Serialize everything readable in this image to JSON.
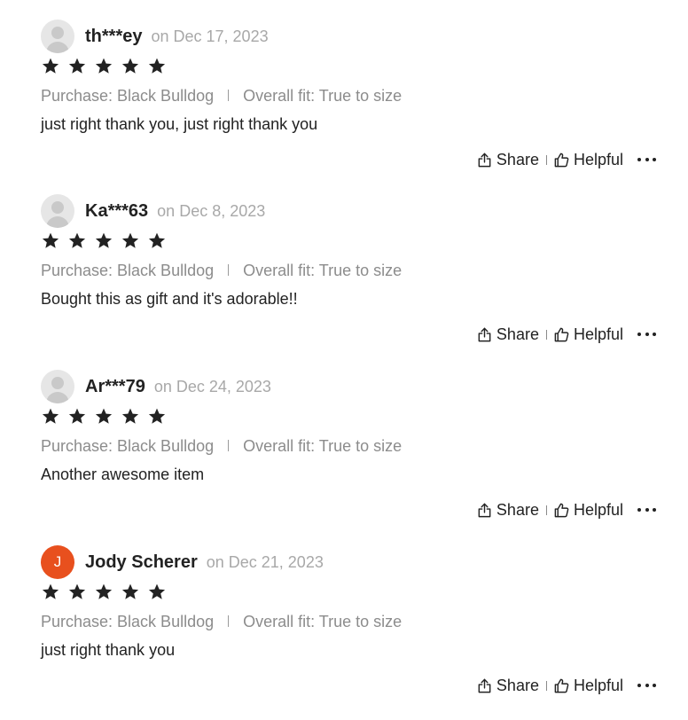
{
  "reviews": [
    {
      "username": "th***ey",
      "date": "on Dec 17, 2023",
      "avatar": {
        "type": "placeholder",
        "initial": ""
      },
      "rating": 5,
      "purchase": "Purchase: Black Bulldog",
      "fit": "Overall fit: True to size",
      "content": "just right thank you, just right thank you",
      "share_label": "Share",
      "helpful_label": "Helpful"
    },
    {
      "username": "Ka***63",
      "date": "on Dec 8, 2023",
      "avatar": {
        "type": "placeholder",
        "initial": ""
      },
      "rating": 5,
      "purchase": "Purchase: Black Bulldog",
      "fit": "Overall fit: True to size",
      "content": "Bought this as gift and it's adorable!!",
      "share_label": "Share",
      "helpful_label": "Helpful"
    },
    {
      "username": "Ar***79",
      "date": "on Dec 24, 2023",
      "avatar": {
        "type": "placeholder",
        "initial": ""
      },
      "rating": 5,
      "purchase": "Purchase: Black Bulldog",
      "fit": "Overall fit: True to size",
      "content": "Another awesome item",
      "share_label": "Share",
      "helpful_label": "Helpful"
    },
    {
      "username": "Jody Scherer",
      "date": "on Dec 21, 2023",
      "avatar": {
        "type": "initial",
        "initial": "J",
        "color": "#e8501e"
      },
      "rating": 5,
      "purchase": "Purchase: Black Bulldog",
      "fit": "Overall fit: True to size",
      "content": "just right thank you",
      "share_label": "Share",
      "helpful_label": "Helpful"
    }
  ],
  "icons": {
    "star": "star-icon",
    "share": "share-icon",
    "helpful": "thumbs-up-icon",
    "more": "more-options-icon",
    "avatar": "user-placeholder-icon"
  },
  "colors": {
    "star": "#222222",
    "date": "#a8a8a8",
    "meta": "#8c8c8c",
    "avatar_placeholder": "#e6e6e6",
    "avatar_initial": "#e8501e"
  }
}
